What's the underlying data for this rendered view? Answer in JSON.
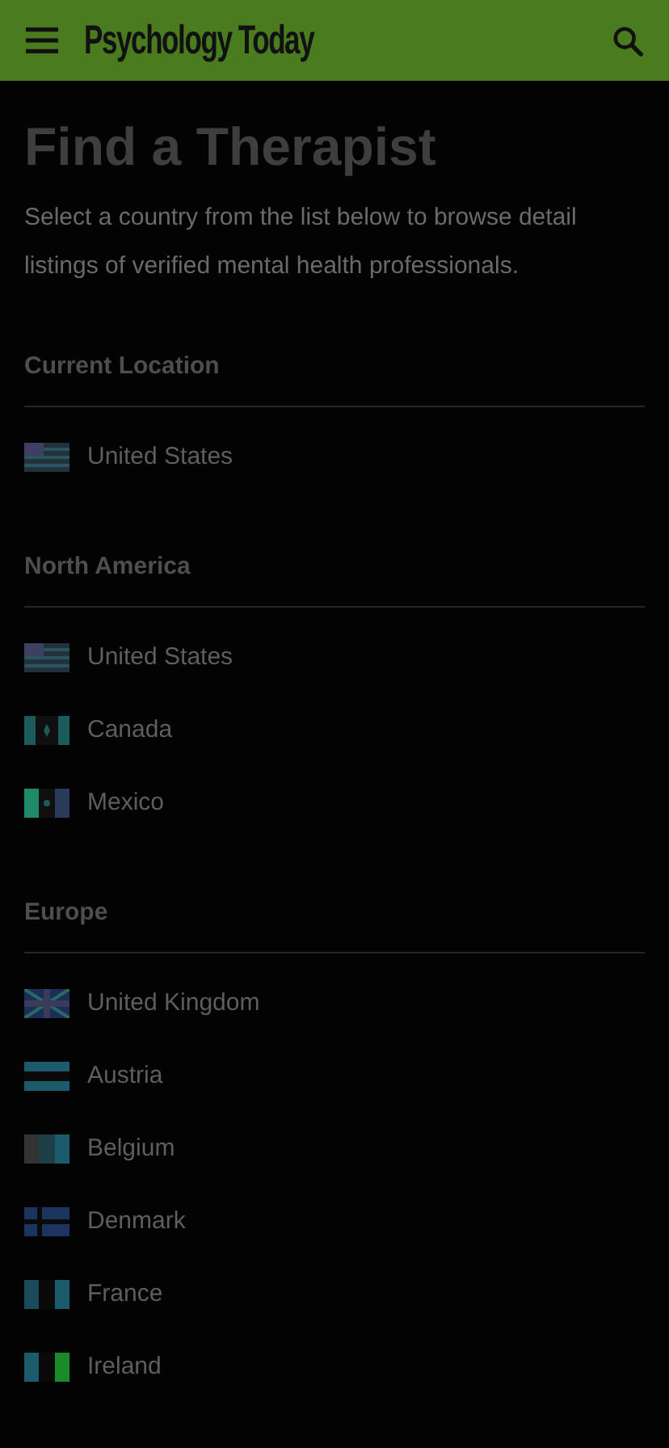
{
  "header": {
    "logo": "Psychology Today"
  },
  "title": "Find a Therapist",
  "intro": "Select a country from the list below to browse detail listings of verified mental health professionals.",
  "sections": [
    {
      "heading": "Current Location",
      "countries": [
        {
          "name": "United States",
          "kind": "stars-stripes"
        }
      ]
    },
    {
      "heading": "North America",
      "countries": [
        {
          "name": "United States",
          "kind": "stars-stripes"
        },
        {
          "name": "Canada",
          "kind": "leaf"
        },
        {
          "name": "Mexico",
          "kind": "emblem"
        }
      ]
    },
    {
      "heading": "Europe",
      "countries": [
        {
          "name": "United Kingdom",
          "kind": "union"
        },
        {
          "name": "Austria",
          "kind": "horizontal-bands"
        },
        {
          "name": "Belgium",
          "kind": "tricolor-dark"
        },
        {
          "name": "Denmark",
          "kind": "nordic-cross"
        },
        {
          "name": "France",
          "kind": "tricolor-blue"
        },
        {
          "name": "Ireland",
          "kind": "tricolor-green"
        }
      ]
    }
  ]
}
